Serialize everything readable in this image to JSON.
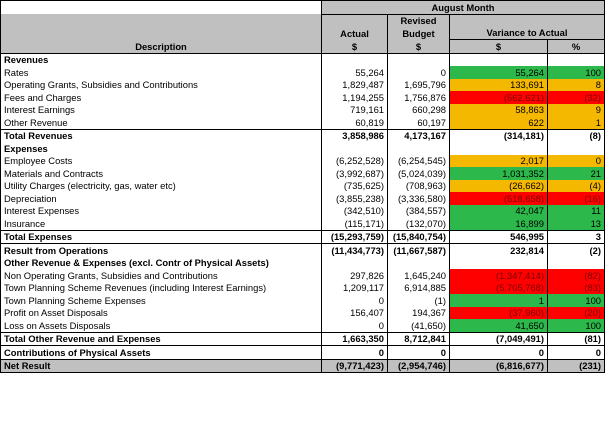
{
  "header": {
    "period": "August Month",
    "description": "Description",
    "actual": "Actual",
    "actual_unit": "$",
    "revised": "Revised",
    "budget": "Budget",
    "budget_unit": "$",
    "variance": "Variance to Actual",
    "var_unit": "$",
    "pct_unit": "%"
  },
  "rows": [
    {
      "desc": "Revenues",
      "actual": "",
      "budget": "",
      "var": "",
      "pct": "",
      "type": "section"
    },
    {
      "desc": "Rates",
      "actual": "55,264",
      "budget": "0",
      "var": "55,264",
      "pct": "100",
      "vc": "g",
      "pc": "g"
    },
    {
      "desc": "Operating Grants, Subsidies and Contributions",
      "actual": "1,829,487",
      "budget": "1,695,796",
      "var": "133,691",
      "pct": "8",
      "vc": "o",
      "pc": "o"
    },
    {
      "desc": "Fees and Charges",
      "actual": "1,194,255",
      "budget": "1,756,876",
      "var": "(562,621)",
      "pct": "(32)",
      "vc": "r",
      "pc": "r"
    },
    {
      "desc": "Interest Earnings",
      "actual": "719,161",
      "budget": "660,298",
      "var": "58,863",
      "pct": "9",
      "vc": "o",
      "pc": "o"
    },
    {
      "desc": "Other Revenue",
      "actual": "60,819",
      "budget": "60,197",
      "var": "622",
      "pct": "1",
      "vc": "o",
      "pc": "o"
    },
    {
      "desc": "Total Revenues",
      "actual": "3,858,986",
      "budget": "4,173,167",
      "var": "(314,181)",
      "pct": "(8)",
      "type": "total"
    },
    {
      "desc": "Expenses",
      "actual": "",
      "budget": "",
      "var": "",
      "pct": "",
      "type": "section"
    },
    {
      "desc": "Employee Costs",
      "actual": "(6,252,528)",
      "budget": "(6,254,545)",
      "var": "2,017",
      "pct": "0",
      "vc": "o",
      "pc": "o"
    },
    {
      "desc": "Materials and Contracts",
      "actual": "(3,992,687)",
      "budget": "(5,024,039)",
      "var": "1,031,352",
      "pct": "21",
      "vc": "g",
      "pc": "g"
    },
    {
      "desc": "Utility Charges (electricity, gas, water etc)",
      "actual": "(735,625)",
      "budget": "(708,963)",
      "var": "(26,662)",
      "pct": "(4)",
      "vc": "o",
      "pc": "o"
    },
    {
      "desc": "Depreciation",
      "actual": "(3,855,238)",
      "budget": "(3,336,580)",
      "var": "(518,658)",
      "pct": "(16)",
      "vc": "r",
      "pc": "r"
    },
    {
      "desc": "Interest Expenses",
      "actual": "(342,510)",
      "budget": "(384,557)",
      "var": "42,047",
      "pct": "11",
      "vc": "g",
      "pc": "g"
    },
    {
      "desc": "Insurance",
      "actual": "(115,171)",
      "budget": "(132,070)",
      "var": "16,899",
      "pct": "13",
      "vc": "g",
      "pc": "g"
    },
    {
      "desc": "Total Expenses",
      "actual": "(15,293,759)",
      "budget": "(15,840,754)",
      "var": "546,995",
      "pct": "3",
      "type": "total"
    },
    {
      "desc": "Result from Operations",
      "actual": "(11,434,773)",
      "budget": "(11,667,587)",
      "var": "232,814",
      "pct": "(2)",
      "type": "total"
    },
    {
      "desc": "Other Revenue & Expenses (excl. Contr of Physical Assets)",
      "actual": "",
      "budget": "",
      "var": "",
      "pct": "",
      "type": "section"
    },
    {
      "desc": "Non Operating Grants, Subsidies and Contributions",
      "actual": "297,826",
      "budget": "1,645,240",
      "var": "(1,347,414)",
      "pct": "(82)",
      "vc": "r",
      "pc": "r"
    },
    {
      "desc": "Town Planning Scheme Revenues (including Interest Earnings)",
      "actual": "1,209,117",
      "budget": "6,914,885",
      "var": "(5,705,768)",
      "pct": "(83)",
      "vc": "r",
      "pc": "r"
    },
    {
      "desc": "Town Planning Scheme Expenses",
      "actual": "0",
      "budget": "(1)",
      "var": "1",
      "pct": "100",
      "vc": "g",
      "pc": "g"
    },
    {
      "desc": "Profit on Asset Disposals",
      "actual": "156,407",
      "budget": "194,367",
      "var": "(37,960)",
      "pct": "(20)",
      "vc": "r",
      "pc": "r"
    },
    {
      "desc": "Loss on Assets Disposals",
      "actual": "0",
      "budget": "(41,650)",
      "var": "41,650",
      "pct": "100",
      "vc": "g",
      "pc": "g"
    },
    {
      "desc": "Total Other Revenue and Expenses",
      "actual": "1,663,350",
      "budget": "8,712,841",
      "var": "(7,049,491)",
      "pct": "(81)",
      "type": "total"
    },
    {
      "desc": "Contributions of Physical Assets",
      "actual": "0",
      "budget": "0",
      "var": "0",
      "pct": "0",
      "type": "total"
    },
    {
      "desc": "Net Result",
      "actual": "(9,771,423)",
      "budget": "(2,954,746)",
      "var": "(6,816,677)",
      "pct": "(231)",
      "type": "net"
    }
  ],
  "colors": {
    "favourable": "#2db84b",
    "neutral": "#f5b800",
    "unfavourable": "#ff0000",
    "header": "#c0c0c0"
  }
}
